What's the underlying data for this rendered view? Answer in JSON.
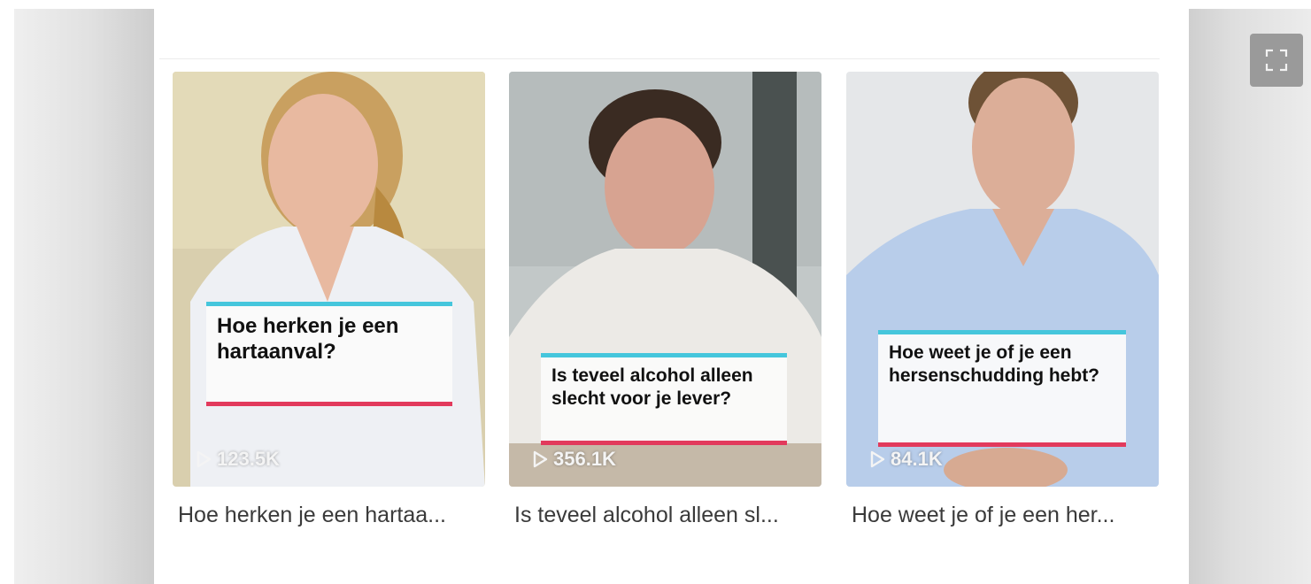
{
  "videos": [
    {
      "overlay_text": "Hoe herken je een hartaanval?",
      "views": "123.5K",
      "title": "Hoe herken je een hartaa..."
    },
    {
      "overlay_text": "Is teveel alcohol alleen slecht voor je lever?",
      "views": "356.1K",
      "title": "Is teveel alcohol alleen sl..."
    },
    {
      "overlay_text": "Hoe weet je of je een hersenschudding hebt?",
      "views": "84.1K",
      "title": "Hoe weet je of je een her..."
    }
  ],
  "icons": {
    "play": "play-icon",
    "fullscreen": "fullscreen-icon"
  },
  "colors": {
    "caption_top_bar": "#45c6dc",
    "caption_bottom_bar": "#e23a5c"
  }
}
